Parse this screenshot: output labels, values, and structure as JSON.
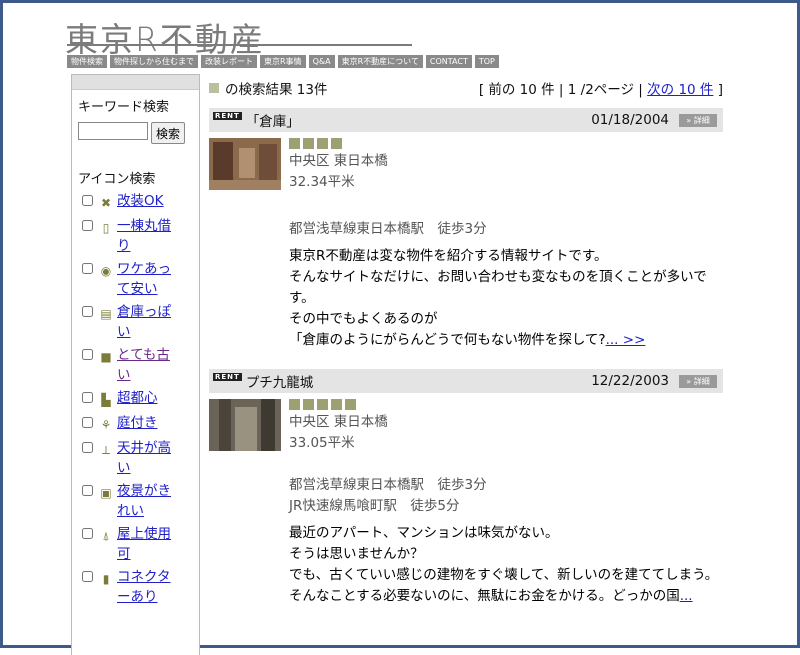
{
  "logo": "東京R不動産",
  "nav": [
    "物件検索",
    "物件探しから住むまで",
    "改装レポート",
    "東京R事情",
    "Q&A",
    "東京R不動産について",
    "CONTACT",
    "TOP"
  ],
  "sidebar": {
    "keyword_title": "キーワード検索",
    "search_button": "検索",
    "search_placeholder": "",
    "icon_title": "アイコン検索",
    "items": [
      {
        "label": "改装OK",
        "icon": "tools-icon"
      },
      {
        "label": "一棟丸借り",
        "icon": "building-icon"
      },
      {
        "label": "ワケあって安い",
        "icon": "discount-icon"
      },
      {
        "label": "倉庫っぽい",
        "icon": "warehouse-icon"
      },
      {
        "label": "とても古い",
        "icon": "old-icon"
      },
      {
        "label": "超都心",
        "icon": "city-icon"
      },
      {
        "label": "庭付き",
        "icon": "garden-icon"
      },
      {
        "label": "天井が高い",
        "icon": "ceiling-icon"
      },
      {
        "label": "夜景がきれい",
        "icon": "nightview-icon"
      },
      {
        "label": "屋上使用可",
        "icon": "rooftop-icon"
      },
      {
        "label": "コネクターあり",
        "icon": "connector-icon"
      }
    ]
  },
  "results": {
    "summary_suffix": "の検索結果 13件",
    "pager_open": "[ 前の 10 件 | 1 /2ページ |",
    "pager_next": "次の 10 件",
    "pager_close": "]"
  },
  "listings": [
    {
      "rent_badge": "RENT",
      "name": "「倉庫」",
      "date": "01/18/2004",
      "detail": "» 詳細",
      "area": "中央区 東日本橋",
      "size": "32.34平米",
      "stations": [
        "都営浅草線東日本橋駅　徒歩3分"
      ],
      "desc": [
        "東京R不動産は変な物件を紹介する情報サイトです。",
        "そんなサイトなだけに、お問い合わせも変なものを頂くことが多いです。",
        "その中でもよくあるのが",
        "「倉庫のようにがらんどうで何もない物件を探して?"
      ],
      "more": "... >>"
    },
    {
      "rent_badge": "RENT",
      "name": "プチ九龍城",
      "date": "12/22/2003",
      "detail": "» 詳細",
      "area": "中央区 東日本橋",
      "size": "33.05平米",
      "stations": [
        "都営浅草線東日本橋駅　徒歩3分",
        "JR快速線馬喰町駅　徒歩5分"
      ],
      "desc": [
        "最近のアパート、マンションは味気がない。",
        "そうは思いませんか？",
        "でも、古くていい感じの建物をすぐ壊して、新しいのを建ててしまう。",
        "そんなことする必要ないのに、無駄にお金をかける。どっかの国"
      ],
      "more": "..."
    }
  ]
}
